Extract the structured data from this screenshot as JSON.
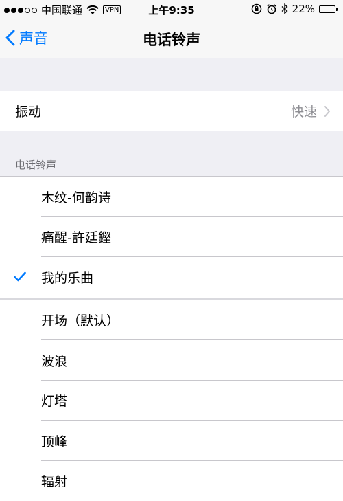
{
  "status_bar": {
    "carrier": "中国联通",
    "vpn": "VPN",
    "time": "上午9:35",
    "battery": "22%",
    "battery_level": 0.22,
    "signal_bars": [
      true,
      true,
      true,
      false,
      false
    ]
  },
  "nav": {
    "back_label": "声音",
    "title": "电话铃声"
  },
  "vibration": {
    "label": "振动",
    "value": "快速"
  },
  "ringtones": {
    "section_header": "电话铃声",
    "purchased": [
      {
        "label": "木纹-何韵诗",
        "selected": false
      },
      {
        "label": "痛醒-許廷鏗",
        "selected": false
      },
      {
        "label": "我的乐曲",
        "selected": true
      }
    ],
    "builtin": [
      {
        "label": "开场（默认）",
        "selected": false
      },
      {
        "label": "波浪",
        "selected": false
      },
      {
        "label": "灯塔",
        "selected": false
      },
      {
        "label": "顶峰",
        "selected": false
      },
      {
        "label": "辐射",
        "selected": false
      }
    ]
  },
  "colors": {
    "accent": "#007aff",
    "secondary_text": "#8e8e93",
    "separator": "#c8c7cc",
    "background": "#efeff4"
  }
}
